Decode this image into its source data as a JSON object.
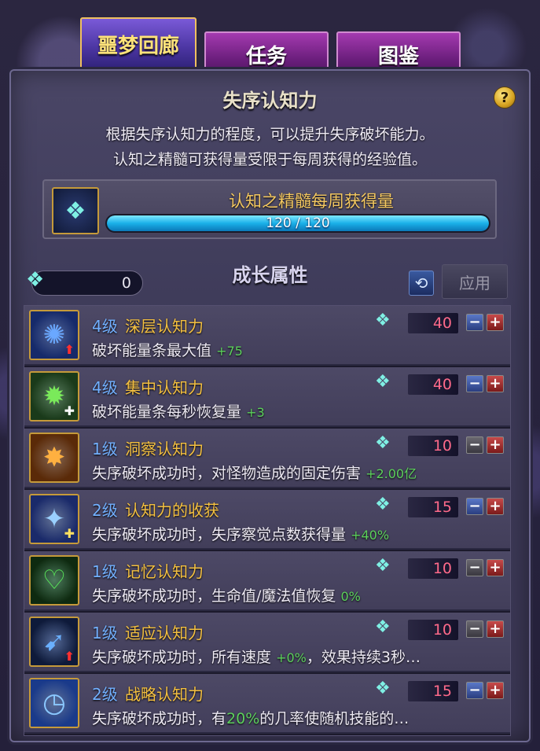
{
  "tabs": [
    {
      "label": "噩梦回廊",
      "active": true
    },
    {
      "label": "任务",
      "active": false
    },
    {
      "label": "图鉴",
      "active": false
    }
  ],
  "title": "失序认知力",
  "help_icon": "?",
  "description": [
    "根据失序认知力的程度，可以提升失序破坏能力。",
    "认知之精髓可获得量受限于每周获得的经验值。"
  ],
  "weekly": {
    "label": "认知之精髓每周获得量",
    "current": 120,
    "max": 120,
    "progress_text": "120 / 120"
  },
  "points": {
    "value": "0",
    "icon": "essence-icon"
  },
  "section_title": "成长属性",
  "reset_icon": "⟲",
  "apply_label": "应用",
  "skills": [
    {
      "level": "4级",
      "name": "深层认知力",
      "effect": "破坏能量条最大值",
      "bonus": "+75",
      "cost": "40",
      "icon": "burst-icon",
      "glyph": "✺",
      "color": "#6aa8ff",
      "bg": "#162a6a",
      "badge": "⬆",
      "badge_color": "#ff3030",
      "minus_enabled": true
    },
    {
      "level": "4级",
      "name": "集中认知力",
      "effect": "破坏能量条每秒恢复量",
      "bonus": "+3",
      "cost": "40",
      "icon": "focus-icon",
      "glyph": "✹",
      "color": "#7aea5a",
      "bg": "#1a3a1a",
      "badge": "✚",
      "badge_color": "#ffffff",
      "minus_enabled": true
    },
    {
      "level": "1级",
      "name": "洞察认知力",
      "effect": "失序破坏成功时，对怪物造成的固定伤害",
      "bonus": "+2.00亿",
      "cost": "10",
      "icon": "slash-icon",
      "glyph": "✸",
      "color": "#ffb040",
      "bg": "#5a2a08",
      "badge": "",
      "badge_color": "#ffffff",
      "minus_enabled": false
    },
    {
      "level": "2级",
      "name": "认知力的收获",
      "effect": "失序破坏成功时，失序察觉点数获得量",
      "bonus": "+40%",
      "cost": "15",
      "icon": "harvest-icon",
      "glyph": "✦",
      "color": "#9ad0ff",
      "bg": "#1a2a6a",
      "badge": "✚",
      "badge_color": "#ffe060",
      "minus_enabled": true
    },
    {
      "level": "1级",
      "name": "记忆认知力",
      "effect": "失序破坏成功时，生命值/魔法值恢复",
      "bonus": "0%",
      "cost": "10",
      "icon": "heart-icon",
      "glyph": "♡",
      "color": "#5aea5a",
      "bg": "#0e2a10",
      "badge": "",
      "badge_color": "#ffffff",
      "minus_enabled": false
    },
    {
      "level": "1级",
      "name": "适应认知力",
      "effect": "失序破坏成功时，所有速度",
      "bonus": "+0%",
      "suffix": "，效果持续3秒…",
      "cost": "10",
      "icon": "running-icon",
      "glyph": "➹",
      "color": "#6ab0ff",
      "bg": "#0e1a3a",
      "badge": "⬆",
      "badge_color": "#ff3030",
      "minus_enabled": false
    },
    {
      "level": "2级",
      "name": "战略认知力",
      "effect_prefix": "失序破坏成功时，有",
      "bonus": "20%",
      "effect": "的几率使随机技能的…",
      "cost": "15",
      "icon": "clock-icon",
      "glyph": "◷",
      "color": "#8ac8ff",
      "bg": "#1a3a8a",
      "badge": "",
      "badge_color": "#ffffff",
      "minus_enabled": true
    }
  ],
  "colors": {
    "accent": "#f4c040",
    "level": "#72b0ff",
    "bonus": "#5cd05c",
    "cost": "#ff6a8a"
  }
}
